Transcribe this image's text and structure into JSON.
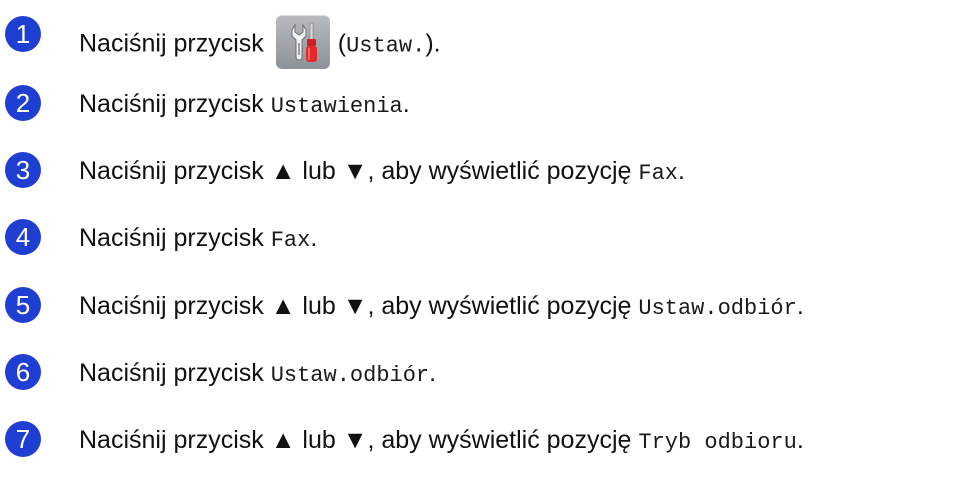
{
  "steps": [
    {
      "number": "1",
      "prefix": "Naciśnij przycisk",
      "button_icon": "wrench-screwdriver-settings-icon",
      "code": "Ustaw.",
      "suffix_open": "(",
      "suffix_close": ")."
    },
    {
      "number": "2",
      "prefix": "Naciśnij przycisk ",
      "code": "Ustawienia",
      "suffix": "."
    },
    {
      "number": "3",
      "prefix": "Naciśnij przycisk ▲ lub ▼, aby wyświetlić pozycję ",
      "code": "Fax",
      "suffix": "."
    },
    {
      "number": "4",
      "prefix": "Naciśnij przycisk ",
      "code": "Fax",
      "suffix": "."
    },
    {
      "number": "5",
      "prefix": "Naciśnij przycisk ▲ lub ▼, aby wyświetlić pozycję ",
      "code": "Ustaw.odbiór",
      "suffix": "."
    },
    {
      "number": "6",
      "prefix": "Naciśnij przycisk ",
      "code": "Ustaw.odbiór",
      "suffix": "."
    },
    {
      "number": "7",
      "prefix": "Naciśnij przycisk ▲ lub ▼, aby wyświetlić pozycję ",
      "code": "Tryb odbioru",
      "suffix": "."
    }
  ],
  "colors": {
    "badge_blue": "#1f3fd3",
    "text": "#111111",
    "settings_button_gray": "#9a9ea4",
    "screwdriver_red": "#d12222"
  }
}
